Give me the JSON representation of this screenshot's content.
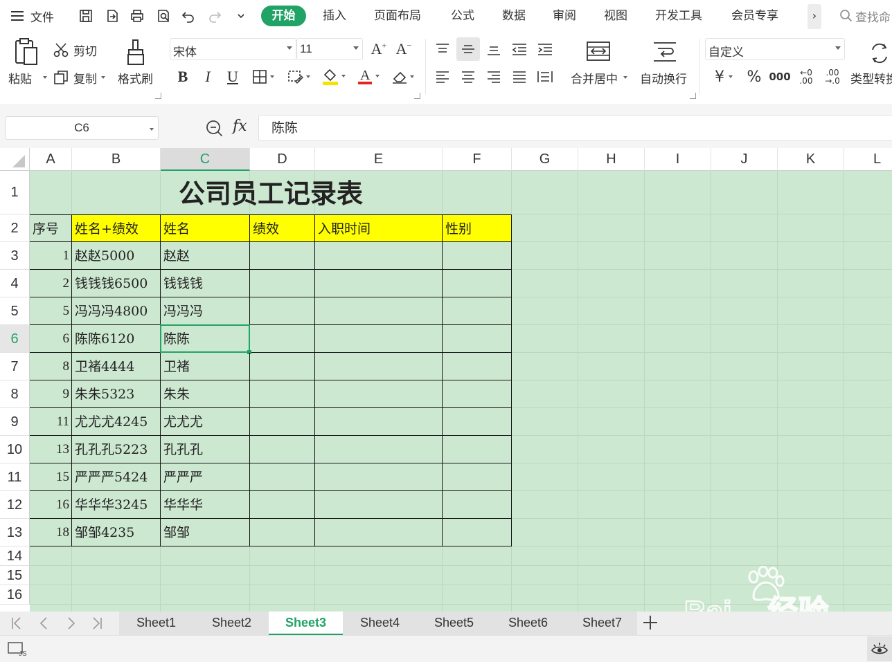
{
  "menu": {
    "file_label": "文件",
    "tabs": [
      "开始",
      "插入",
      "页面布局",
      "公式",
      "数据",
      "审阅",
      "视图",
      "开发工具",
      "会员专享"
    ],
    "search_placeholder": "查找命"
  },
  "ribbon": {
    "paste": "粘贴",
    "cut": "剪切",
    "copy": "复制",
    "format_painter": "格式刷",
    "font_name": "宋体",
    "font_size": "11",
    "merge_center": "合并居中",
    "wrap_text": "自动换行",
    "number_format": "自定义",
    "type_convert": "类型转换"
  },
  "formula_bar": {
    "name_box": "C6",
    "fx": "fx",
    "content": "陈陈"
  },
  "sheet": {
    "columns": [
      "A",
      "B",
      "C",
      "D",
      "E",
      "F",
      "G",
      "H",
      "I",
      "J",
      "K",
      "L"
    ],
    "rows": [
      "1",
      "2",
      "3",
      "4",
      "5",
      "6",
      "7",
      "8",
      "9",
      "10",
      "11",
      "12",
      "13",
      "14",
      "15",
      "16"
    ],
    "title": "公司员工记录表",
    "headers": [
      "序号",
      "姓名+绩效",
      "姓名",
      "绩效",
      "入职时间",
      "性别"
    ],
    "records": [
      {
        "no": "1",
        "name_perf": "赵赵5000",
        "name": "赵赵"
      },
      {
        "no": "2",
        "name_perf": "钱钱钱6500",
        "name": "钱钱钱"
      },
      {
        "no": "5",
        "name_perf": "冯冯冯4800",
        "name": "冯冯冯"
      },
      {
        "no": "6",
        "name_perf": "陈陈6120",
        "name": "陈陈"
      },
      {
        "no": "8",
        "name_perf": "卫褚4444",
        "name": "卫褚"
      },
      {
        "no": "9",
        "name_perf": "朱朱5323",
        "name": "朱朱"
      },
      {
        "no": "11",
        "name_perf": "尤尤尤4245",
        "name": "尤尤尤"
      },
      {
        "no": "13",
        "name_perf": "孔孔孔5223",
        "name": "孔孔孔"
      },
      {
        "no": "15",
        "name_perf": "严严严5424",
        "name": "严严严"
      },
      {
        "no": "16",
        "name_perf": "华华华3245",
        "name": "华华华"
      },
      {
        "no": "18",
        "name_perf": "邹邹4235",
        "name": "邹邹"
      }
    ],
    "selected_cell": "C6"
  },
  "sheet_tabs": [
    "Sheet1",
    "Sheet2",
    "Sheet3",
    "Sheet4",
    "Sheet5",
    "Sheet6",
    "Sheet7"
  ],
  "active_sheet": "Sheet3",
  "watermark": "Baidu经验 jingyan.baidu.com",
  "colors": {
    "accent": "#21a366",
    "cell_bg": "#cde8d1",
    "header_yellow": "#ffff00"
  }
}
